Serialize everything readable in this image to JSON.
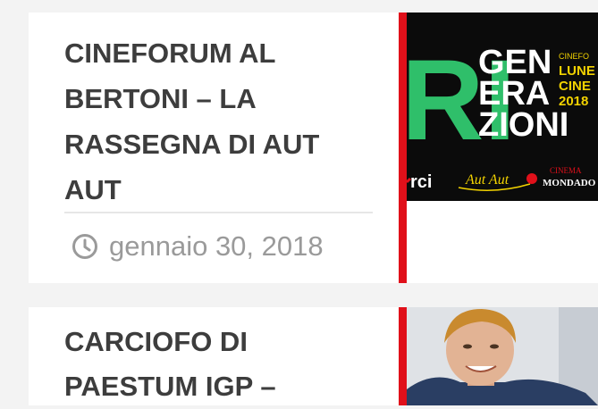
{
  "posts": [
    {
      "title": "CINEFORUM AL BERTONI – LA RASSEGNA DI AUT AUT",
      "date": "gennaio 30, 2018",
      "date_icon": "clock-icon",
      "thumbnail": {
        "headline_lines": [
          "GEN",
          "ERA",
          "ZIONI"
        ],
        "side_lines": [
          "CINEFO",
          "LUNE",
          "CINE",
          "2018"
        ],
        "footer_left": "rci",
        "footer_middle": "Aut Aut",
        "footer_right_top": "CINEMA",
        "footer_right": "MONDADO"
      }
    },
    {
      "title": "CARCIOFO DI PAESTUM IGP –",
      "thumbnail": {
        "subject": "portrait-photo"
      }
    }
  ],
  "colors": {
    "accent": "#e0101a",
    "title": "#3d3d3d",
    "meta": "#9a9a9a",
    "promo_green": "#2fbf6a",
    "promo_yellow": "#f2d200"
  }
}
